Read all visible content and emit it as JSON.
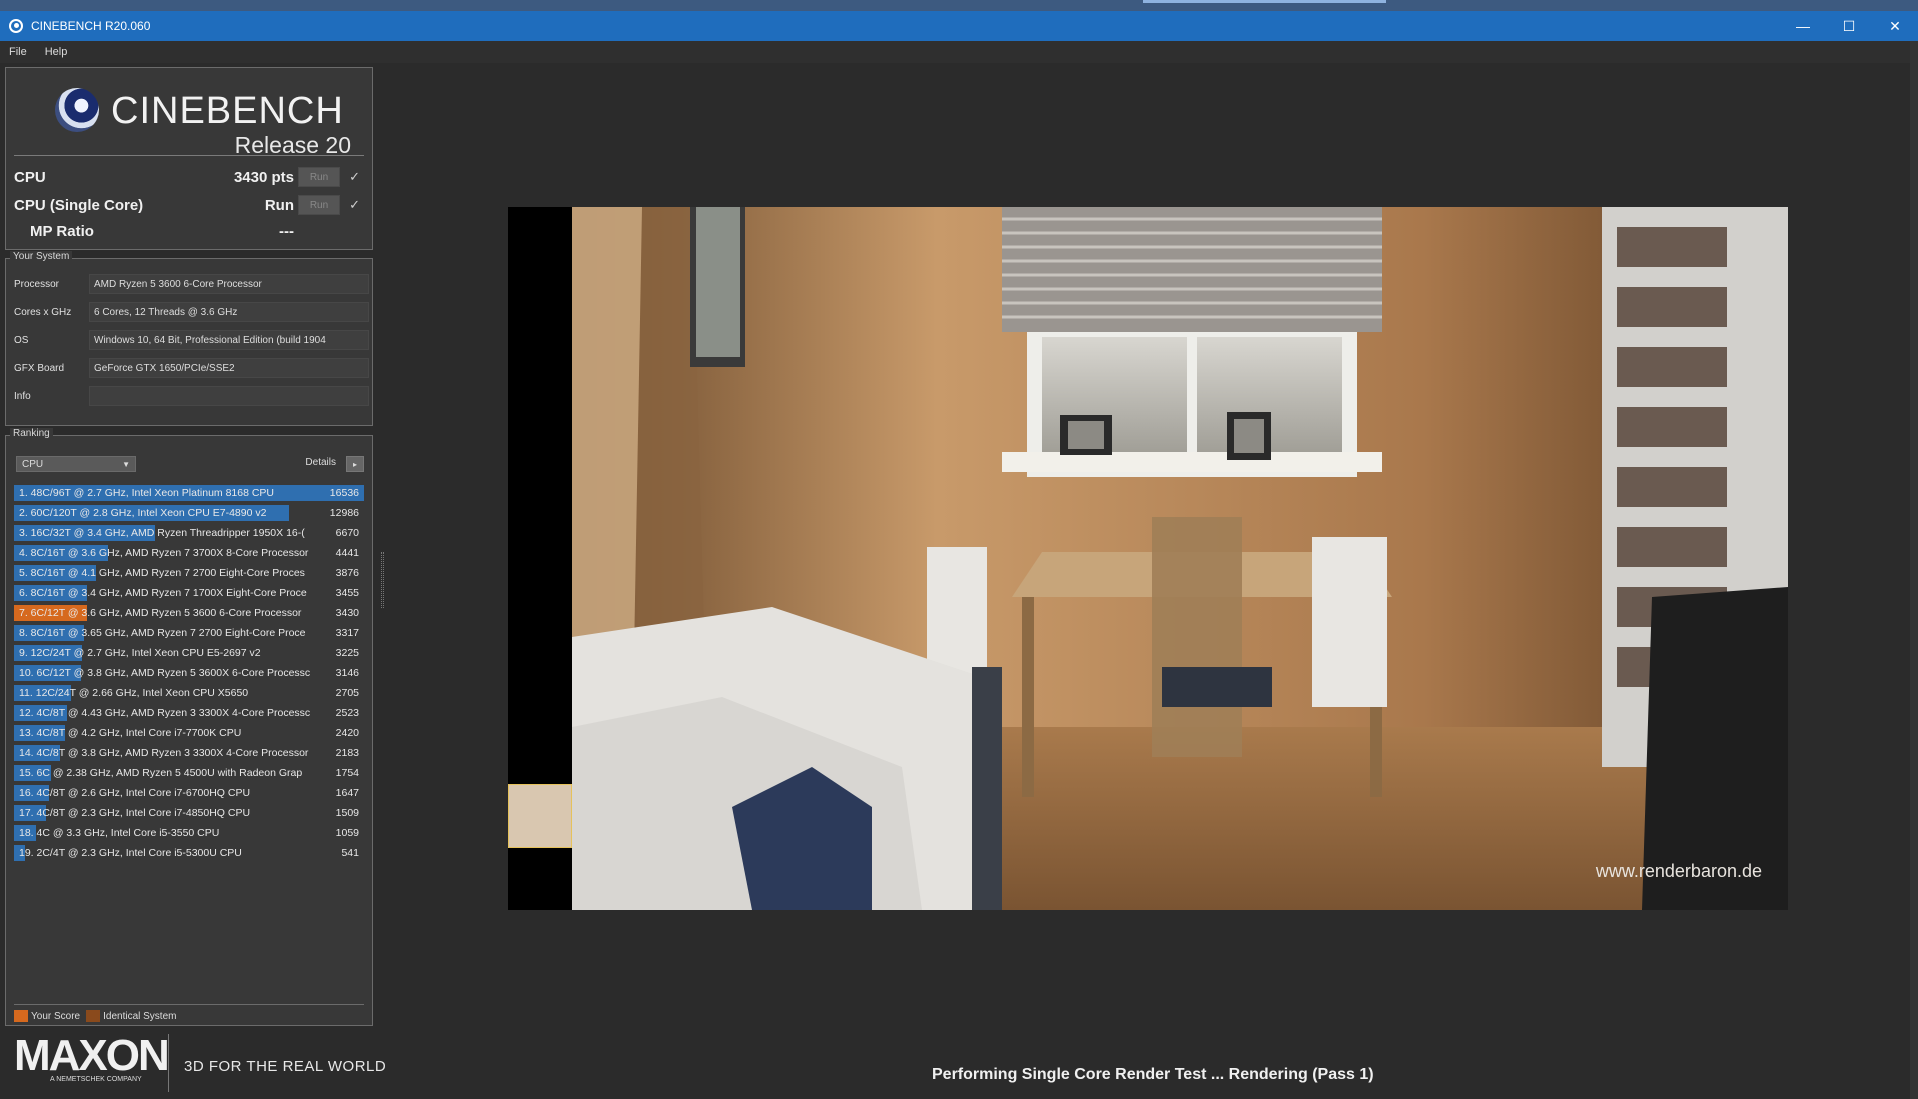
{
  "window": {
    "title": "CINEBENCH R20.060"
  },
  "window_controls": {
    "minimize": "—",
    "maximize": "☐",
    "close": "✕"
  },
  "menu": {
    "items": [
      "File",
      "Help"
    ]
  },
  "logo": {
    "name": "CINEBENCH",
    "release": "Release 20"
  },
  "scores": {
    "cpu": {
      "label": "CPU",
      "value": "3430 pts",
      "run_label": "Run",
      "check": "✓"
    },
    "single": {
      "label": "CPU (Single Core)",
      "value": "Run",
      "run_label": "Run",
      "check": "✓"
    },
    "mp": {
      "label": "MP Ratio",
      "value": "---"
    }
  },
  "system": {
    "title": "Your System",
    "rows": [
      {
        "label": "Processor",
        "value": "AMD Ryzen 5 3600 6-Core Processor"
      },
      {
        "label": "Cores x GHz",
        "value": "6 Cores, 12 Threads @ 3.6 GHz"
      },
      {
        "label": "OS",
        "value": "Windows 10, 64 Bit, Professional Edition (build 1904"
      },
      {
        "label": "GFX Board",
        "value": "GeForce GTX 1650/PCIe/SSE2"
      },
      {
        "label": "Info",
        "value": ""
      }
    ]
  },
  "ranking": {
    "title": "Ranking",
    "dropdown": "CPU",
    "details_label": "Details",
    "details_btn": "▸",
    "max_score": 16536,
    "rows": [
      {
        "text": "1. 48C/96T @ 2.7 GHz, Intel Xeon Platinum 8168 CPU",
        "score": "16536",
        "value": 16536,
        "selected": true
      },
      {
        "text": "2. 60C/120T @ 2.8 GHz, Intel Xeon CPU E7-4890 v2",
        "score": "12986",
        "value": 12986
      },
      {
        "text": "3. 16C/32T @ 3.4 GHz, AMD Ryzen Threadripper 1950X 16-(",
        "score": "6670",
        "value": 6670
      },
      {
        "text": "4. 8C/16T @ 3.6 GHz, AMD Ryzen 7 3700X 8-Core Processor",
        "score": "4441",
        "value": 4441
      },
      {
        "text": "5. 8C/16T @ 4.1 GHz, AMD Ryzen 7 2700 Eight-Core Proces",
        "score": "3876",
        "value": 3876
      },
      {
        "text": "6. 8C/16T @ 3.4 GHz, AMD Ryzen 7 1700X Eight-Core Proce",
        "score": "3455",
        "value": 3455
      },
      {
        "text": "7. 6C/12T @ 3.6 GHz, AMD Ryzen 5 3600 6-Core Processor",
        "score": "3430",
        "value": 3430,
        "mine": true
      },
      {
        "text": "8. 8C/16T @ 3.65 GHz, AMD Ryzen 7 2700 Eight-Core Proce",
        "score": "3317",
        "value": 3317
      },
      {
        "text": "9. 12C/24T @ 2.7 GHz, Intel Xeon CPU E5-2697 v2",
        "score": "3225",
        "value": 3225
      },
      {
        "text": "10. 6C/12T @ 3.8 GHz, AMD Ryzen 5 3600X 6-Core Processc",
        "score": "3146",
        "value": 3146
      },
      {
        "text": "11. 12C/24T @ 2.66 GHz, Intel Xeon CPU X5650",
        "score": "2705",
        "value": 2705
      },
      {
        "text": "12. 4C/8T @ 4.43 GHz, AMD Ryzen 3 3300X 4-Core Processc",
        "score": "2523",
        "value": 2523
      },
      {
        "text": "13. 4C/8T @ 4.2 GHz, Intel Core i7-7700K CPU",
        "score": "2420",
        "value": 2420
      },
      {
        "text": "14. 4C/8T @ 3.8 GHz, AMD Ryzen 3 3300X 4-Core Processor",
        "score": "2183",
        "value": 2183
      },
      {
        "text": "15. 6C @ 2.38 GHz, AMD Ryzen 5 4500U with Radeon Grap",
        "score": "1754",
        "value": 1754
      },
      {
        "text": "16. 4C/8T @ 2.6 GHz, Intel Core i7-6700HQ CPU",
        "score": "1647",
        "value": 1647
      },
      {
        "text": "17. 4C/8T @ 2.3 GHz, Intel Core i7-4850HQ CPU",
        "score": "1509",
        "value": 1509
      },
      {
        "text": "18. 4C @ 3.3 GHz, Intel Core i5-3550 CPU",
        "score": "1059",
        "value": 1059
      },
      {
        "text": "19. 2C/4T @ 2.3 GHz, Intel Core i5-5300U CPU",
        "score": "541",
        "value": 541
      }
    ]
  },
  "legend": {
    "your_score": "Your Score",
    "identical": "Identical System",
    "your_color": "#d6691e",
    "identical_color": "#8a4a1c"
  },
  "footer": {
    "brand": "MAXON",
    "brand_sub": "A NEMETSCHEK COMPANY",
    "tagline": "3D FOR THE REAL WORLD"
  },
  "render": {
    "watermark": "www.renderbaron.de",
    "status": "Performing Single Core Render Test ... Rendering (Pass 1)"
  }
}
